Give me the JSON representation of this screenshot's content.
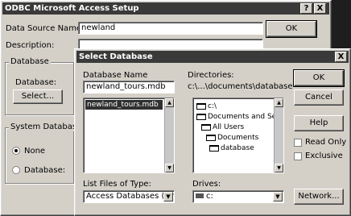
{
  "setup_window": {
    "title": "ODBC Microsoft Access Setup",
    "help_btn": "?",
    "close_btn": "X",
    "data_source_name_label": "Data Source Name:",
    "data_source_name_value": "newland",
    "description_label": "Description:",
    "description_value": "",
    "ok_label": "OK",
    "database_group": "Database",
    "database_label": "Database:",
    "select_label": "Select...",
    "system_database_group": "System Database",
    "radio_none": "None",
    "radio_database": "Database:"
  },
  "select_window": {
    "title": "Select Database",
    "close_btn": "X",
    "db_name_label": "Database Name",
    "db_name_value": "newland_tours.mdb",
    "file_list": [
      "newland_tours.mdb"
    ],
    "directories_label": "Directories:",
    "current_dir": "c:\\...\\documents\\database",
    "dir_tree": [
      "c:\\",
      "Documents and Se",
      "All Users",
      "Documents",
      "database"
    ],
    "file_type_label": "List Files of Type:",
    "file_type_value": "Access Databases (*.m",
    "drives_label": "Drives:",
    "drive_value": "c:",
    "ok_label": "OK",
    "cancel_label": "Cancel",
    "help_label": "Help",
    "readonly_label": "Read Only",
    "exclusive_label": "Exclusive",
    "network_label": "Network..."
  },
  "icons": {
    "dropdown": "▼",
    "scroll_up": "▲",
    "scroll_down": "▼"
  }
}
